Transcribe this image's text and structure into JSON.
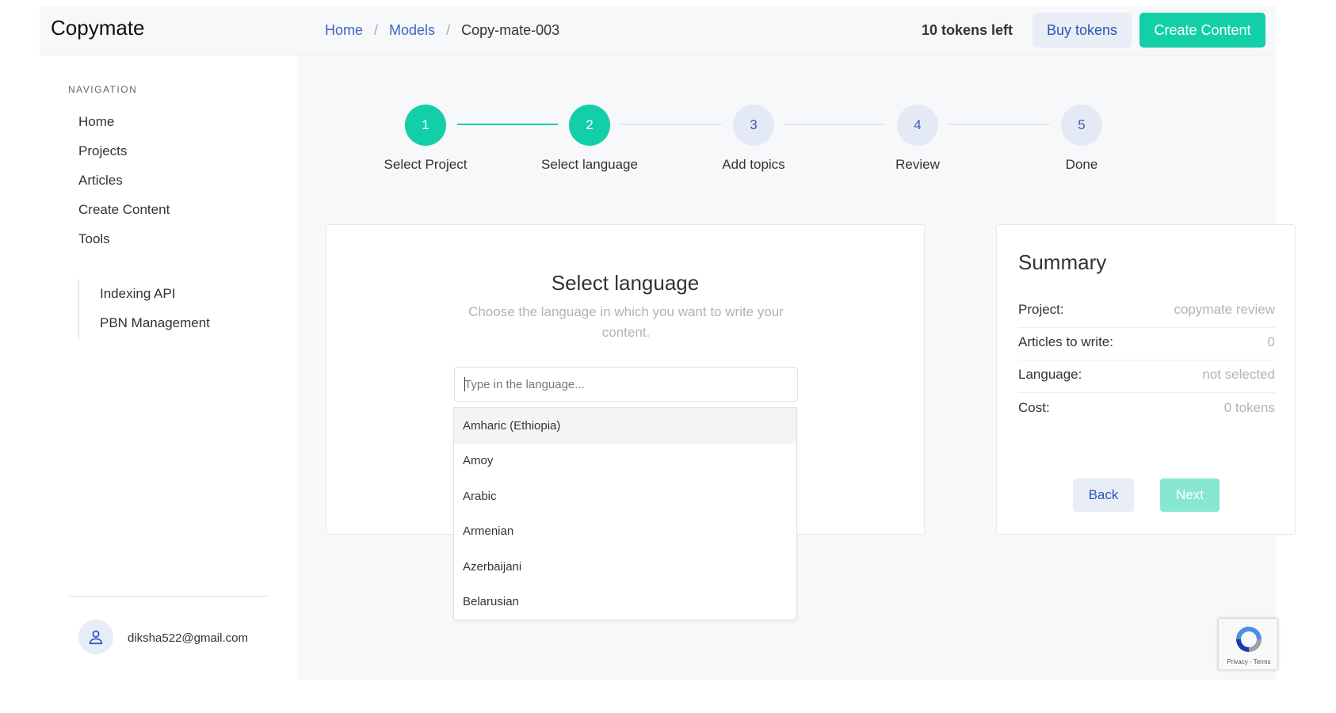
{
  "app": {
    "logo": "Copymate"
  },
  "header": {
    "breadcrumb": [
      "Home",
      "Models",
      "Copy-mate-003"
    ],
    "tokens_left": "10 tokens left",
    "buy_tokens": "Buy tokens",
    "create_content": "Create Content"
  },
  "sidebar": {
    "nav_title": "NAVIGATION",
    "items": [
      "Home",
      "Projects",
      "Articles",
      "Create Content",
      "Tools"
    ],
    "sub_items": [
      "Indexing API",
      "PBN Management"
    ],
    "user_email": "diksha522@gmail.com",
    "user_icon": "user-icon"
  },
  "stepper": {
    "steps": [
      {
        "num": "1",
        "label": "Select Project",
        "state": "done"
      },
      {
        "num": "2",
        "label": "Select language",
        "state": "active"
      },
      {
        "num": "3",
        "label": "Add topics",
        "state": "pending"
      },
      {
        "num": "4",
        "label": "Review",
        "state": "pending"
      },
      {
        "num": "5",
        "label": "Done",
        "state": "pending"
      }
    ]
  },
  "language": {
    "title": "Select language",
    "subtitle": "Choose the language in which you want to write your content.",
    "input_placeholder": "Type in the language...",
    "options": [
      "Amharic (Ethiopia)",
      "Amoy",
      "Arabic",
      "Armenian",
      "Azerbaijani",
      "Belarusian"
    ],
    "highlighted": "Amharic (Ethiopia)"
  },
  "summary": {
    "title": "Summary",
    "rows": [
      {
        "key": "Project:",
        "value": "copymate review"
      },
      {
        "key": "Articles to write:",
        "value": "0"
      },
      {
        "key": "Language:",
        "value": "not selected"
      },
      {
        "key": "Cost:",
        "value": "0 tokens"
      }
    ],
    "back": "Back",
    "next": "Next"
  },
  "recaptcha": {
    "text": "Privacy - Terms"
  },
  "colors": {
    "accent": "#13cfa8",
    "link": "#3d63c8",
    "muted": "#b0b3b8"
  }
}
